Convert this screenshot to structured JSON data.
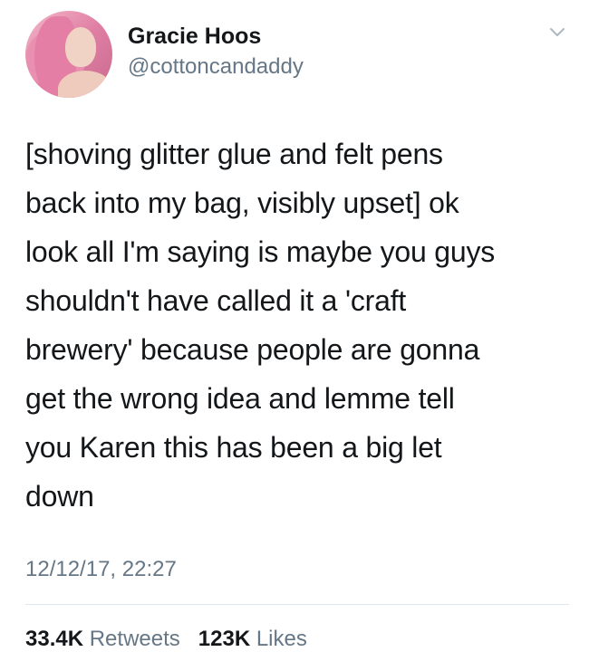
{
  "user": {
    "display_name": "Gracie Hoos",
    "handle": "@cottoncandaddy"
  },
  "tweet": {
    "lines": [
      "[shoving glitter glue and felt pens",
      "back into my bag, visibly upset] ok",
      "look all I'm saying is maybe you guys",
      "shouldn't have called it a 'craft",
      "brewery' because people are gonna",
      "get the wrong idea and lemme tell",
      "you Karen this has been a big let",
      "down"
    ],
    "timestamp": "12/12/17, 22:27"
  },
  "stats": {
    "retweets_count": "33.4K",
    "retweets_label": "Retweets",
    "likes_count": "123K",
    "likes_label": "Likes"
  },
  "icons": {
    "menu": "chevron-down-icon",
    "avatar": "avatar"
  },
  "colors": {
    "text_primary": "#14171a",
    "text_secondary": "#657786",
    "divider": "#e1e8ed"
  }
}
